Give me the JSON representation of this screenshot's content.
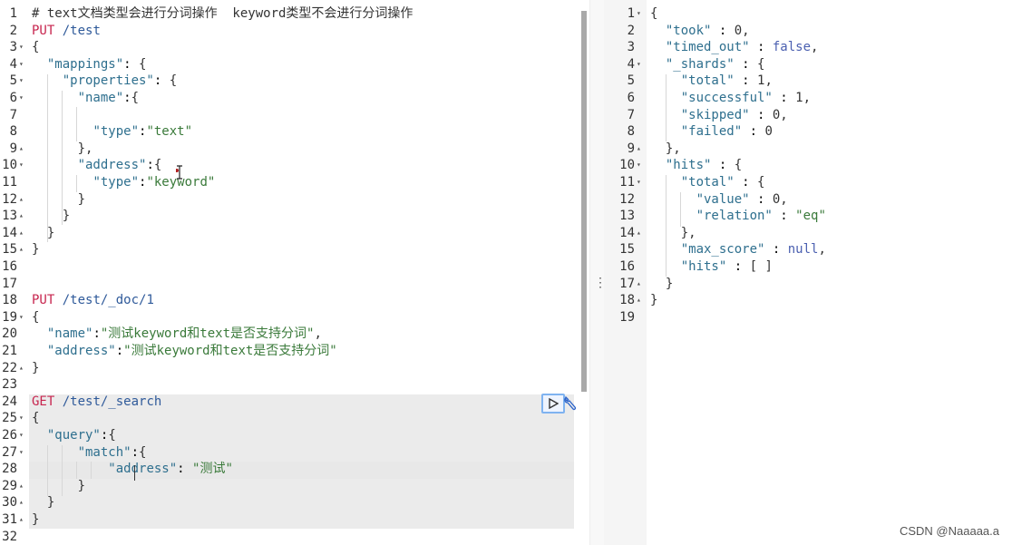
{
  "editor": {
    "lines": [
      {
        "n": "1",
        "fold": "",
        "code": "# text文档类型会进行分词操作  keyword类型不会进行分词操作"
      },
      {
        "n": "2",
        "fold": "",
        "code": "PUT /test"
      },
      {
        "n": "3",
        "fold": "▾",
        "code": "{"
      },
      {
        "n": "4",
        "fold": "▾",
        "code": "  \"mappings\": {"
      },
      {
        "n": "5",
        "fold": "▾",
        "code": "    \"properties\": {"
      },
      {
        "n": "6",
        "fold": "▾",
        "code": "      \"name\":{"
      },
      {
        "n": "7",
        "fold": "",
        "code": ""
      },
      {
        "n": "8",
        "fold": "",
        "code": "        \"type\":\"text\""
      },
      {
        "n": "9",
        "fold": "▴",
        "code": "      },"
      },
      {
        "n": "10",
        "fold": "▾",
        "code": "      \"address\":{"
      },
      {
        "n": "11",
        "fold": "",
        "code": "        \"type\":\"keyword\""
      },
      {
        "n": "12",
        "fold": "▴",
        "code": "      }"
      },
      {
        "n": "13",
        "fold": "▴",
        "code": "    }"
      },
      {
        "n": "14",
        "fold": "▴",
        "code": "  }"
      },
      {
        "n": "15",
        "fold": "▴",
        "code": "}"
      },
      {
        "n": "16",
        "fold": "",
        "code": ""
      },
      {
        "n": "17",
        "fold": "",
        "code": ""
      },
      {
        "n": "18",
        "fold": "",
        "code": "PUT /test/_doc/1"
      },
      {
        "n": "19",
        "fold": "▾",
        "code": "{"
      },
      {
        "n": "20",
        "fold": "",
        "code": "  \"name\":\"测试keyword和text是否支持分词\","
      },
      {
        "n": "21",
        "fold": "",
        "code": "  \"address\":\"测试keyword和text是否支持分词\""
      },
      {
        "n": "22",
        "fold": "▴",
        "code": "}"
      },
      {
        "n": "23",
        "fold": "",
        "code": ""
      },
      {
        "n": "24",
        "fold": "",
        "code": "GET /test/_search"
      },
      {
        "n": "25",
        "fold": "▾",
        "code": "{"
      },
      {
        "n": "26",
        "fold": "▾",
        "code": "  \"query\":{"
      },
      {
        "n": "27",
        "fold": "▾",
        "code": "      \"match\":{"
      },
      {
        "n": "28",
        "fold": "",
        "code": "          \"address\": \"测试\""
      },
      {
        "n": "29",
        "fold": "▴",
        "code": "      }"
      },
      {
        "n": "30",
        "fold": "▴",
        "code": "  }"
      },
      {
        "n": "31",
        "fold": "▴",
        "code": "}"
      },
      {
        "n": "32",
        "fold": "",
        "code": ""
      }
    ]
  },
  "response": {
    "lines": [
      {
        "n": "1",
        "fold": "▾",
        "code": "{"
      },
      {
        "n": "2",
        "fold": "",
        "code": "  \"took\" : 0,"
      },
      {
        "n": "3",
        "fold": "",
        "code": "  \"timed_out\" : false,"
      },
      {
        "n": "4",
        "fold": "▾",
        "code": "  \"_shards\" : {"
      },
      {
        "n": "5",
        "fold": "",
        "code": "    \"total\" : 1,"
      },
      {
        "n": "6",
        "fold": "",
        "code": "    \"successful\" : 1,"
      },
      {
        "n": "7",
        "fold": "",
        "code": "    \"skipped\" : 0,"
      },
      {
        "n": "8",
        "fold": "",
        "code": "    \"failed\" : 0"
      },
      {
        "n": "9",
        "fold": "▴",
        "code": "  },"
      },
      {
        "n": "10",
        "fold": "▾",
        "code": "  \"hits\" : {"
      },
      {
        "n": "11",
        "fold": "▾",
        "code": "    \"total\" : {"
      },
      {
        "n": "12",
        "fold": "",
        "code": "      \"value\" : 0,"
      },
      {
        "n": "13",
        "fold": "",
        "code": "      \"relation\" : \"eq\""
      },
      {
        "n": "14",
        "fold": "▴",
        "code": "    },"
      },
      {
        "n": "15",
        "fold": "",
        "code": "    \"max_score\" : null,"
      },
      {
        "n": "16",
        "fold": "",
        "code": "    \"hits\" : [ ]"
      },
      {
        "n": "17",
        "fold": "▴",
        "code": "  }"
      },
      {
        "n": "18",
        "fold": "▴",
        "code": "}"
      },
      {
        "n": "19",
        "fold": "",
        "code": ""
      }
    ]
  },
  "toolbar": {
    "run_icon": "play-icon",
    "settings_icon": "wrench-icon"
  },
  "divider_icon": "vertical-dots-icon",
  "watermark": "CSDN @Naaaaa.a"
}
